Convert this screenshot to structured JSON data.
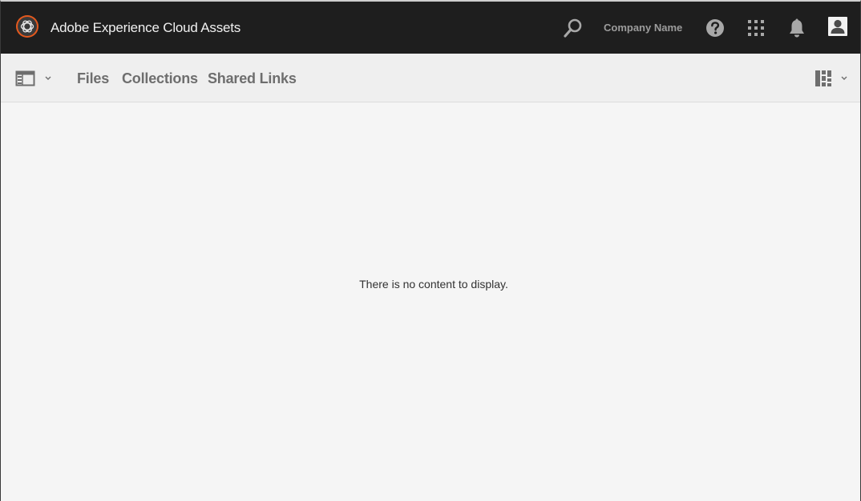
{
  "shell": {
    "app_title": "Adobe Experience Cloud Assets",
    "company_name": "Company Name",
    "icons": [
      "adobe-experience-cloud-logo",
      "search-icon",
      "help-icon",
      "apps-grid-icon",
      "bell-icon",
      "user-avatar-icon"
    ],
    "colors": {
      "shell_background": "#1e1e1e",
      "logo_accent": "#e4581d"
    }
  },
  "actionbar": {
    "nav": [
      "Files",
      "Collections",
      "Shared Links"
    ],
    "icons": [
      "rail-toggle-icon",
      "chevron-down-icon",
      "view-switcher-icon"
    ]
  },
  "content": {
    "empty_message": "There is no content to display."
  }
}
